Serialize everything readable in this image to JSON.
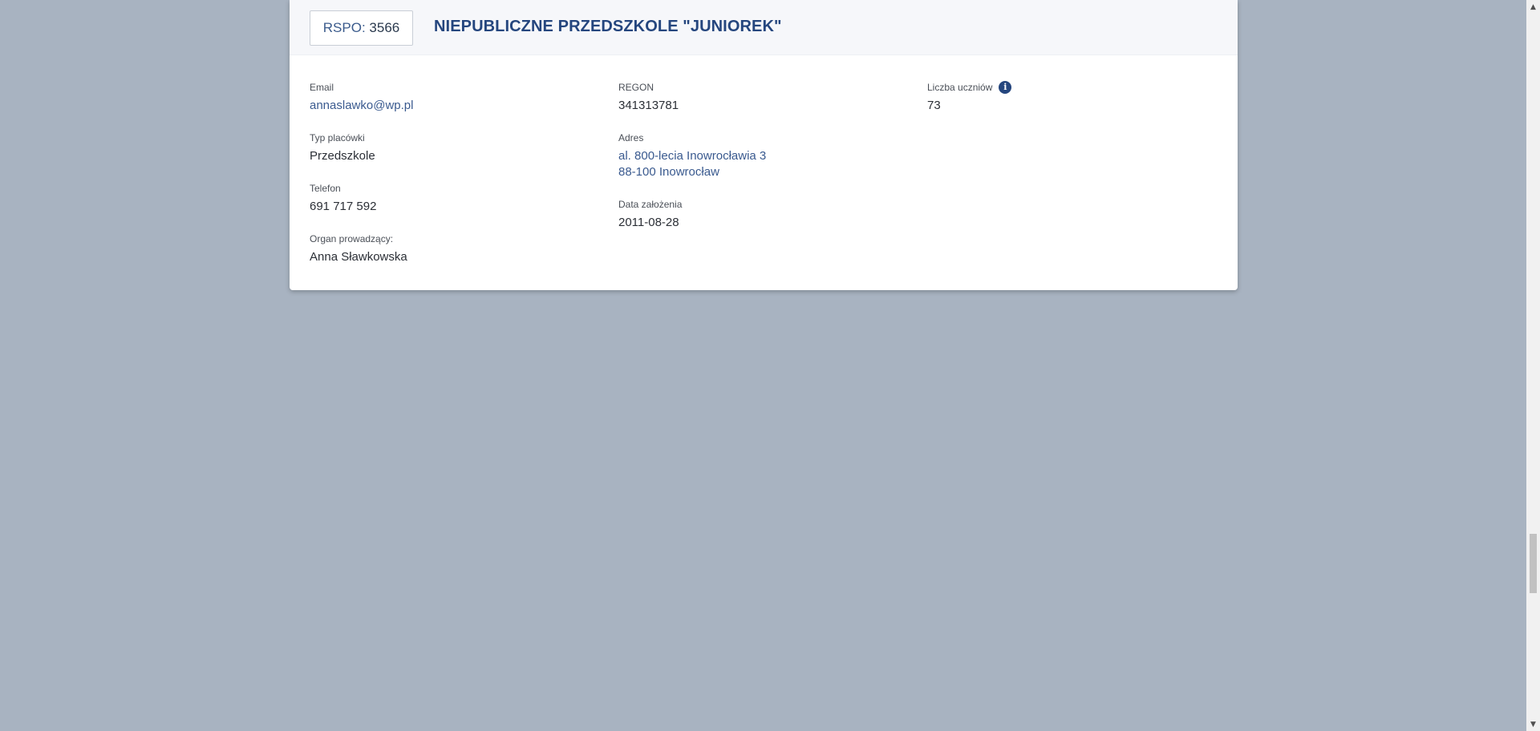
{
  "header": {
    "rspo_prefix": "RSPO:",
    "rspo_number": "3566",
    "school_name": "NIEPUBLICZNE PRZEDSZKOLE \"JUNIOREK\""
  },
  "fields": {
    "email": {
      "label": "Email",
      "value": "annaslawko@wp.pl"
    },
    "type": {
      "label": "Typ placówki",
      "value": "Przedszkole"
    },
    "phone": {
      "label": "Telefon",
      "value": "691 717 592"
    },
    "organ": {
      "label": "Organ prowadzący:",
      "value": "Anna Sławkowska"
    },
    "regon": {
      "label": "REGON",
      "value": "341313781"
    },
    "address": {
      "label": "Adres",
      "line1": "al. 800-lecia Inowrocławia 3",
      "line2": "88-100 Inowrocław"
    },
    "founded": {
      "label": "Data założenia",
      "value": "2011-08-28"
    },
    "students": {
      "label": "Liczba uczniów",
      "value": "73"
    }
  },
  "icons": {
    "info": "info-icon",
    "scroll_up": "chevron-up-icon",
    "scroll_down": "chevron-down-icon"
  },
  "colors": {
    "page_background": "#a8b3c1",
    "accent": "#25467e",
    "link": "#3a5a8f"
  }
}
